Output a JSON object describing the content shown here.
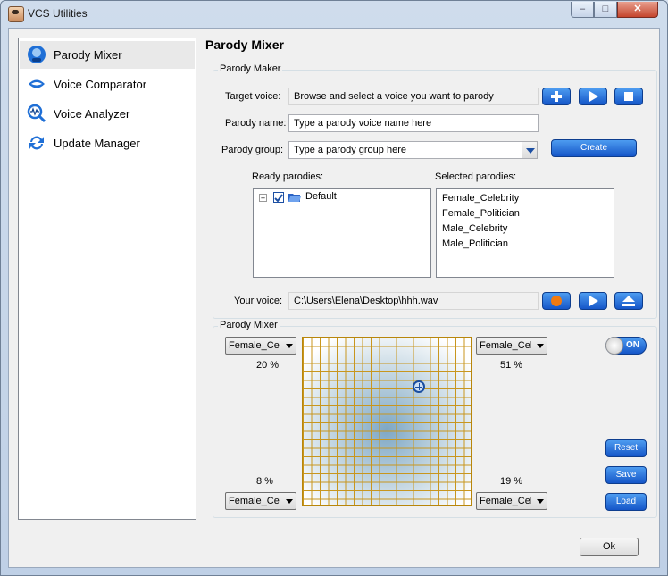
{
  "window": {
    "title": "VCS Utilities",
    "minimize": "–",
    "maximize": "□",
    "close": "✕"
  },
  "sidebar": {
    "items": [
      {
        "label": "Parody Mixer",
        "icon": "parody-mixer-icon",
        "selected": true
      },
      {
        "label": "Voice Comparator",
        "icon": "voice-comparator-icon",
        "selected": false
      },
      {
        "label": "Voice Analyzer",
        "icon": "voice-analyzer-icon",
        "selected": false
      },
      {
        "label": "Update Manager",
        "icon": "update-manager-icon",
        "selected": false
      }
    ]
  },
  "page": {
    "title": "Parody Mixer"
  },
  "parody_maker": {
    "group_label": "Parody Maker",
    "target_voice_label": "Target voice:",
    "target_voice_value": "Browse and select a voice you want to parody",
    "parody_name_label": "Parody name:",
    "parody_name_value": "Type a parody voice name here",
    "parody_group_label": "Parody group:",
    "parody_group_value": "Type a parody group here",
    "create_label": "Create",
    "ready_label": "Ready parodies:",
    "tree_expand": "+",
    "tree_root": "Default",
    "selected_label": "Selected parodies:",
    "selected_items": [
      "Female_Celebrity",
      "Female_Politician",
      "Male_Celebrity",
      "Male_Politician"
    ],
    "your_voice_label": "Your voice:",
    "your_voice_value": "C:\\Users\\Elena\\Desktop\\hhh.wav"
  },
  "mixer": {
    "group_label": "Parody Mixer",
    "top_left": {
      "value": "Female_Celebrity",
      "percent": "20 %"
    },
    "top_right": {
      "value": "Female_Celebrity",
      "percent": "51 %"
    },
    "bottom_left": {
      "value": "Female_Celebrity",
      "percent": "8 %"
    },
    "bottom_right": {
      "value": "Female_Celebrity",
      "percent": "19 %"
    },
    "toggle_label": "ON",
    "reset_label": "Reset",
    "save_label": "Save",
    "load_label": "Load"
  },
  "footer": {
    "ok_label": "Ok"
  },
  "colors": {
    "accent": "#1556c8",
    "record": "#f07a10"
  }
}
